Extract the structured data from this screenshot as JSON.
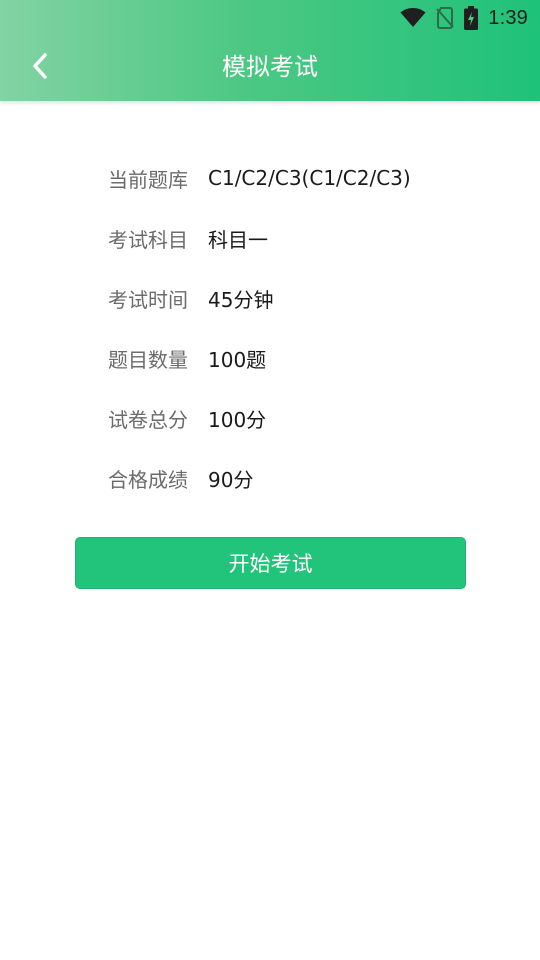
{
  "status_bar": {
    "time": "1:39",
    "icons": [
      "wifi-icon",
      "no-sim-icon",
      "battery-charging-icon"
    ]
  },
  "header": {
    "title": "模拟考试",
    "back_icon": "chevron-left-icon"
  },
  "exam_info": [
    {
      "label": "当前题库",
      "value": "C1/C2/C3(C1/C2/C3)"
    },
    {
      "label": "考试科目",
      "value": "科目一"
    },
    {
      "label": "考试时间",
      "value": "45分钟"
    },
    {
      "label": "题目数量",
      "value": "100题"
    },
    {
      "label": "试卷总分",
      "value": "100分"
    },
    {
      "label": "合格成绩",
      "value": "90分"
    }
  ],
  "start_button": {
    "label": "开始考试"
  },
  "colors": {
    "header_gradient_start": "#83d3a3",
    "header_gradient_end": "#1fc27a",
    "button": "#22c47b",
    "label_text": "#6b6b6b",
    "value_text": "#1a1a1a"
  }
}
